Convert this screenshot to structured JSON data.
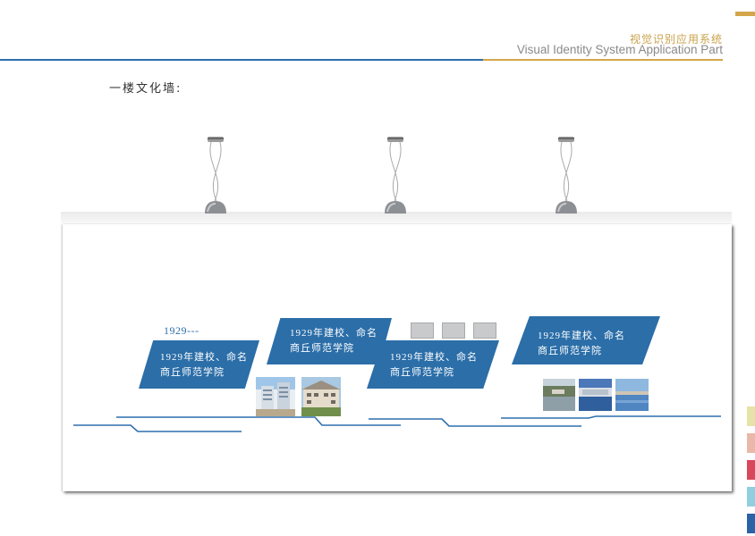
{
  "header": {
    "title_cn": "视觉识别应用系统",
    "title_en": "Visual Identity System Application Part"
  },
  "section": {
    "title": "一楼文化墙:"
  },
  "timeline": {
    "year": "1929---",
    "panels": [
      {
        "line1": "1929年建校、命名",
        "line2": "商丘师范学院"
      },
      {
        "line1": "1929年建校、命名",
        "line2": "商丘师范学院"
      },
      {
        "line1": "1929年建校、命名",
        "line2": "商丘师范学院"
      },
      {
        "line1": "1929年建校、命名",
        "line2": "商丘师范学院"
      }
    ]
  },
  "colors": {
    "accent_gold": "#d4a64a",
    "brand_blue": "#2e6fae",
    "panel_blue": "#2b6ea8",
    "swatches": [
      "#e6e3a6",
      "#eab8a8",
      "#d9475c",
      "#8fcfe0",
      "#2a63a6"
    ]
  }
}
